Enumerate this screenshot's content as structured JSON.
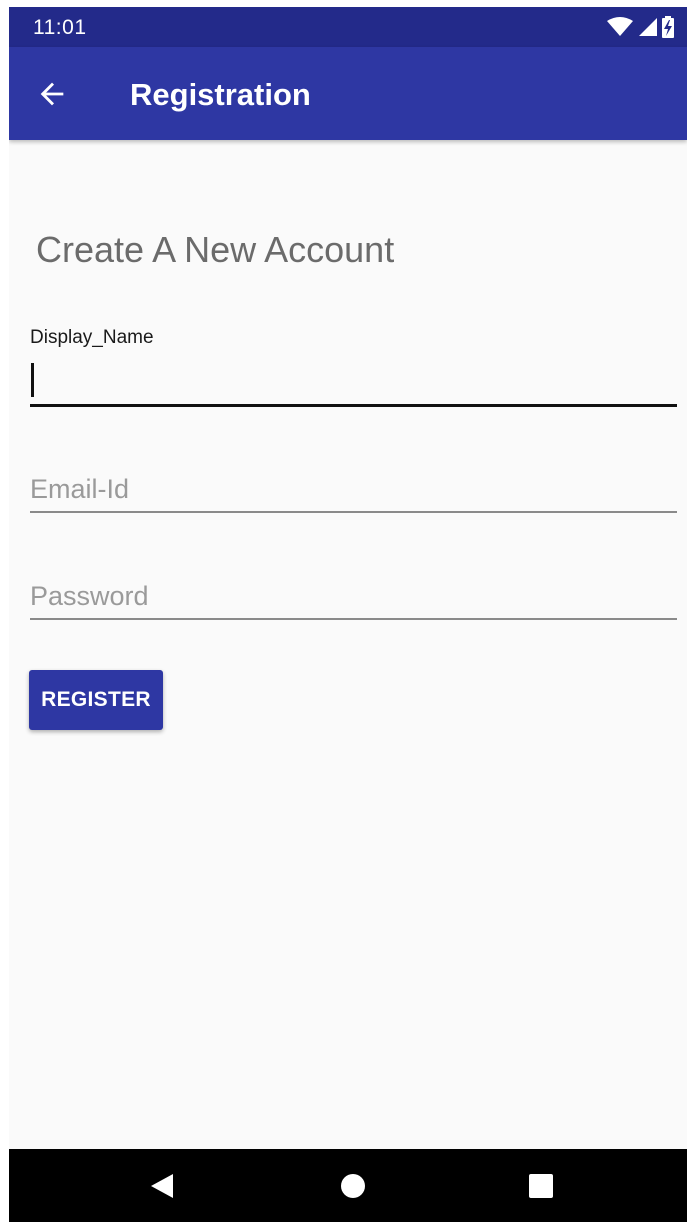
{
  "status_bar": {
    "time": "11:01",
    "icons": [
      "wifi-icon",
      "signal-icon",
      "battery-charging-icon"
    ]
  },
  "app_bar": {
    "title": "Registration",
    "back_icon": "arrow-left-icon"
  },
  "form": {
    "heading": "Create A New Account",
    "display_name": {
      "label": "Display_Name",
      "value": "",
      "focused": true
    },
    "email": {
      "placeholder": "Email-Id",
      "value": ""
    },
    "password": {
      "placeholder": "Password",
      "value": ""
    },
    "register_label": "REGISTER"
  },
  "nav_bar": {
    "icons": [
      "back-triangle-icon",
      "home-circle-icon",
      "recents-square-icon"
    ]
  },
  "colors": {
    "primary": "#2e37a3",
    "status_bar": "#232a8a",
    "background": "#fafafa"
  }
}
